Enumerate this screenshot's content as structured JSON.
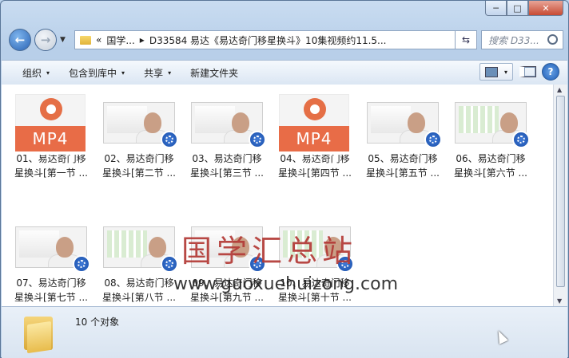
{
  "window": {
    "minimize_icon": "minimize-icon",
    "maximize_icon": "maximize-icon",
    "close_icon": "close-icon"
  },
  "address": {
    "overflow": "«",
    "crumb1": "国学...",
    "sep": "▸",
    "crumb2": "D33584 易达《易达奇门移星换斗》10集视频约11.5...",
    "dropdown": "▾",
    "refresh": "⇆"
  },
  "search": {
    "placeholder": "搜索 D33..."
  },
  "toolbar": {
    "organize": "组织",
    "include": "包含到库中",
    "share": "共享",
    "new_folder": "新建文件夹",
    "arrow": "▾",
    "help": "?"
  },
  "files": [
    {
      "line1": "01、易达奇门移",
      "line2": "星换斗[第一节 ...",
      "type": "mp4"
    },
    {
      "line1": "02、易达奇门移",
      "line2": "星换斗[第二节 ...",
      "type": "video"
    },
    {
      "line1": "03、易达奇门移",
      "line2": "星换斗[第三节 ...",
      "type": "video"
    },
    {
      "line1": "04、易达奇门移",
      "line2": "星换斗[第四节 ...",
      "type": "mp4"
    },
    {
      "line1": "05、易达奇门移",
      "line2": "星换斗[第五节 ...",
      "type": "video"
    },
    {
      "line1": "06、易达奇门移",
      "line2": "星换斗[第六节 ...",
      "type": "video-green"
    },
    {
      "line1": "07、易达奇门移",
      "line2": "星换斗[第七节 ...",
      "type": "video"
    },
    {
      "line1": "08、易达奇门移",
      "line2": "星换斗[第八节 ...",
      "type": "video-green"
    },
    {
      "line1": "09、易达奇门移",
      "line2": "星换斗[第九节 ...",
      "type": "video"
    },
    {
      "line1": "10、易达奇门移",
      "line2": "星换斗[第十节 ...",
      "type": "video-green"
    }
  ],
  "mp4_label": "MP4",
  "watermark": {
    "text": "国学汇总站",
    "url": "www.guoxuehuizong.com"
  },
  "status": {
    "count": "10 个对象"
  }
}
